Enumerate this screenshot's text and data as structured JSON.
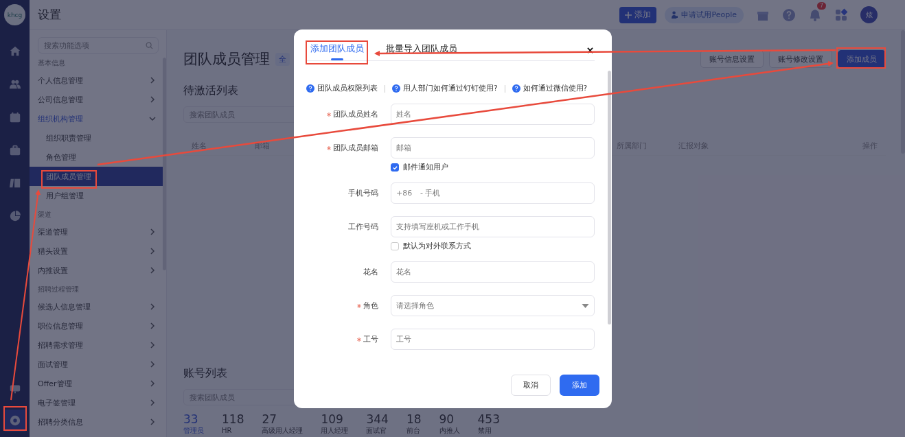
{
  "rail": {
    "logo": "khcg",
    "items": [
      {
        "kind": "home",
        "selected": false
      },
      {
        "kind": "people",
        "selected": false
      },
      {
        "kind": "calendar",
        "selected": false
      },
      {
        "kind": "briefcase",
        "selected": false
      },
      {
        "kind": "book",
        "selected": false
      },
      {
        "kind": "pie",
        "selected": false
      }
    ],
    "bottom_items": [
      {
        "kind": "monitor",
        "selected": false
      },
      {
        "kind": "settings",
        "selected": true
      }
    ]
  },
  "header": {
    "title": "设置",
    "add_button": "添加",
    "trial_button": "申请试用People",
    "notification_count": "7",
    "avatar": "炫"
  },
  "sidebar": {
    "search": {
      "placeholder": "搜索功能选项"
    },
    "groups": [
      {
        "heading": "基本信息",
        "items": [
          {
            "label": "个人信息管理",
            "expanded": false
          },
          {
            "label": "公司信息管理",
            "expanded": false
          },
          {
            "label": "组织机构管理",
            "expanded": true,
            "children": [
              {
                "label": "组织职责管理",
                "selected": false
              },
              {
                "label": "角色管理",
                "selected": false
              },
              {
                "label": "团队成员管理",
                "selected": true
              },
              {
                "label": "用户组管理",
                "selected": false
              }
            ]
          }
        ]
      },
      {
        "heading": "渠道",
        "items": [
          {
            "label": "渠道管理",
            "expanded": false
          },
          {
            "label": "猎头设置",
            "expanded": false
          },
          {
            "label": "内推设置",
            "expanded": false
          }
        ]
      },
      {
        "heading": "招聘过程管理",
        "items": [
          {
            "label": "候选人信息管理",
            "expanded": false
          },
          {
            "label": "职位信息管理",
            "expanded": false
          },
          {
            "label": "招聘需求管理",
            "expanded": false
          },
          {
            "label": "面试管理",
            "expanded": false
          },
          {
            "label": "Offer管理",
            "expanded": false
          },
          {
            "label": "电子签管理",
            "expanded": false
          },
          {
            "label": "招聘分类信息",
            "expanded": false
          }
        ]
      }
    ]
  },
  "main": {
    "title": "团队成员管理",
    "title_badge": "全",
    "buttons": [
      {
        "label": "账号信息设置",
        "kind": "outline"
      },
      {
        "label": "账号修改设置",
        "kind": "outline"
      },
      {
        "label": "添加成员",
        "kind": "primary"
      }
    ],
    "pending": {
      "title": "待激活列表",
      "search": {
        "placeholder": "搜索团队成员"
      },
      "columns": [
        "姓名",
        "邮箱",
        "所属部门",
        "汇报对象",
        "操作"
      ]
    },
    "accounts": {
      "title": "账号列表",
      "search": {
        "placeholder": "搜索团队成员"
      },
      "stats": [
        {
          "value": "33",
          "label": "管理员",
          "selected": true
        },
        {
          "value": "118",
          "label": "HR",
          "selected": false
        },
        {
          "value": "27",
          "label": "高级用人经理",
          "selected": false
        },
        {
          "value": "109",
          "label": "用人经理",
          "selected": false
        },
        {
          "value": "344",
          "label": "面试官",
          "selected": false
        },
        {
          "value": "18",
          "label": "前台",
          "selected": false
        },
        {
          "value": "90",
          "label": "内推人",
          "selected": false
        },
        {
          "value": "453",
          "label": "禁用",
          "selected": false
        }
      ]
    }
  },
  "modal": {
    "tabs": [
      {
        "label": "添加团队成员",
        "selected": true
      },
      {
        "label": "批量导入团队成员",
        "selected": false
      }
    ],
    "help_links": [
      "团队成员权限列表",
      "用人部门如何通过钉钉使用?",
      "如何通过微信使用?"
    ],
    "fields": [
      {
        "kind": "text",
        "label": "团队成员姓名",
        "required": true,
        "placeholder": "姓名"
      },
      {
        "kind": "text",
        "label": "团队成员邮箱",
        "required": true,
        "placeholder": "邮箱",
        "checkbox": {
          "label": "邮件通知用户",
          "checked": true
        }
      },
      {
        "kind": "phone",
        "label": "手机号码",
        "required": false,
        "prefix": "+86",
        "placeholder": "- 手机"
      },
      {
        "kind": "text",
        "label": "工作号码",
        "required": false,
        "placeholder": "支持填写座机或工作手机",
        "checkbox": {
          "label": "默认为对外联系方式",
          "checked": false
        }
      },
      {
        "kind": "text",
        "label": "花名",
        "required": false,
        "placeholder": "花名"
      },
      {
        "kind": "select",
        "label": "角色",
        "required": true,
        "placeholder": "请选择角色"
      },
      {
        "kind": "text",
        "label": "工号",
        "required": true,
        "placeholder": "工号"
      }
    ],
    "cancel": "取消",
    "submit": "添加"
  }
}
